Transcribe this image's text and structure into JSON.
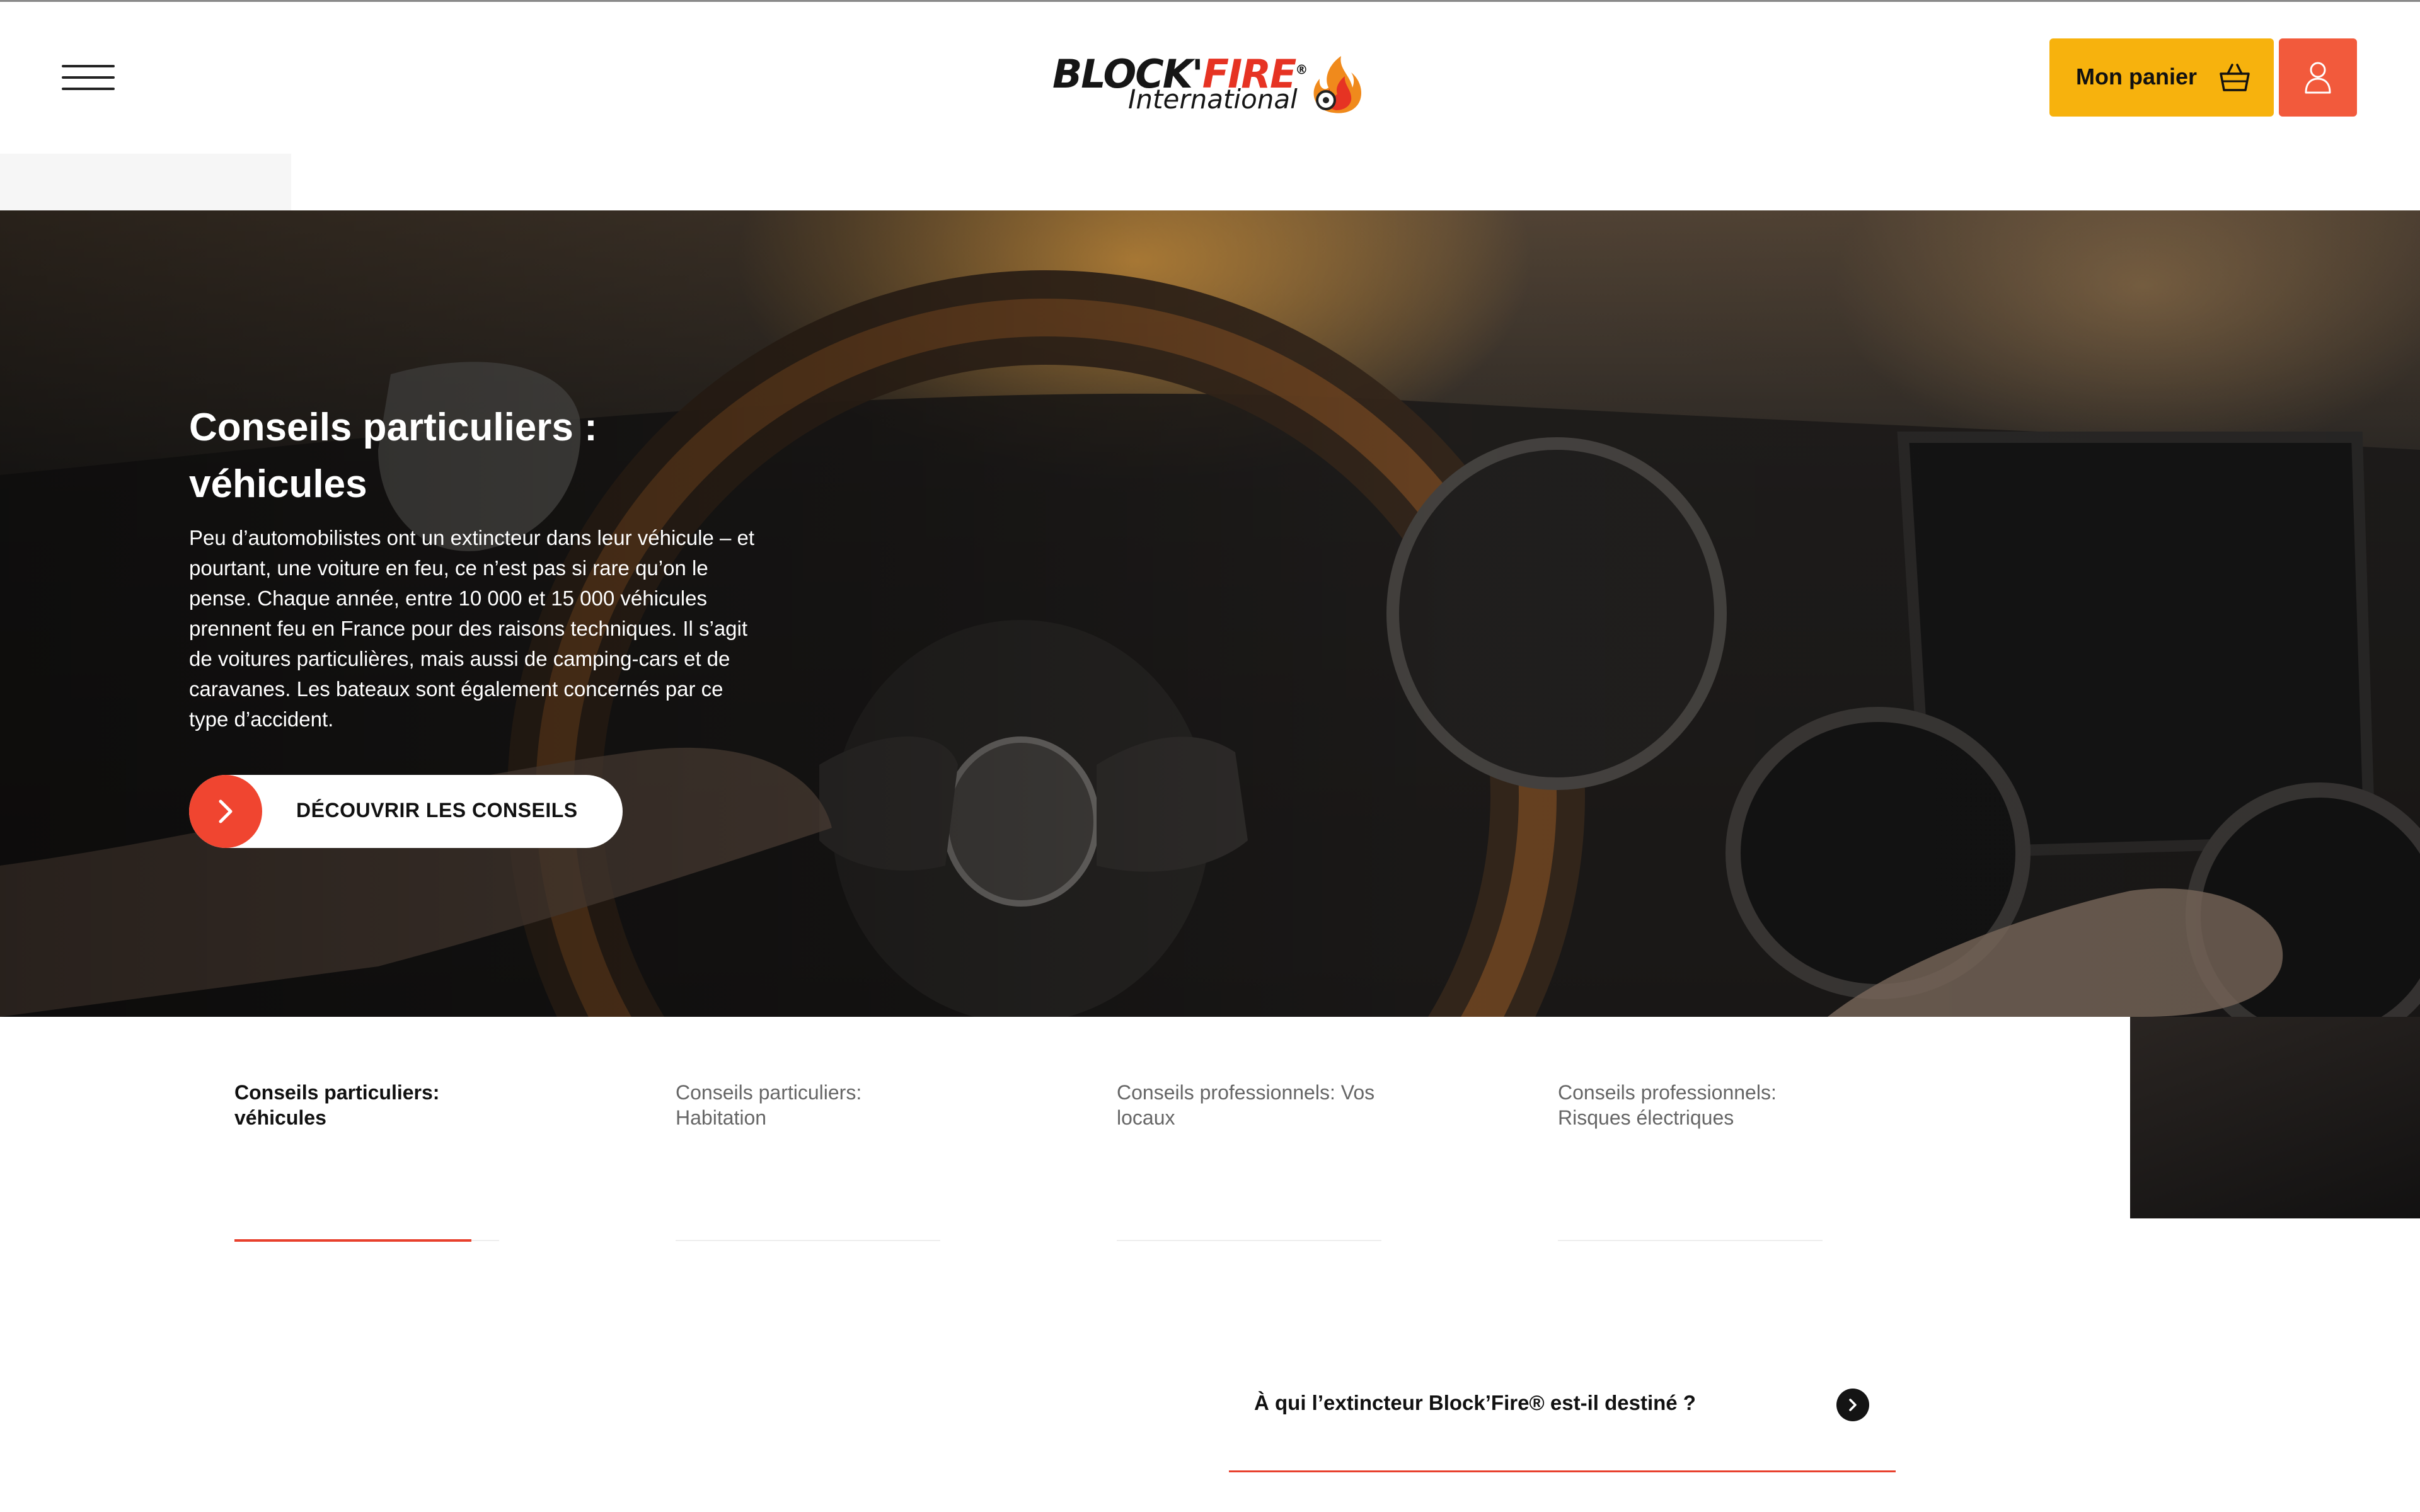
{
  "header": {
    "menu_icon": "hamburger-menu-icon",
    "logo": {
      "brand": "BLOCK'",
      "brand_accent": "FIRE",
      "registered": "®",
      "subtitle": "International"
    },
    "cart_label": "Mon panier",
    "cart_icon": "basket-icon",
    "account_icon": "user-icon",
    "colors": {
      "cart": "#f7b20d",
      "account": "#f25a3c",
      "accent": "#e8402d"
    }
  },
  "hero": {
    "title": "Conseils particuliers : véhicules",
    "text": "Peu d’automobilistes ont un extincteur dans leur véhicule – et pourtant, une voiture en feu, ce n’est pas si rare qu’on le pense. Chaque année, entre 10 000 et 15 000 véhicules prennent feu en France pour des raisons techniques. Il s’agit de voitures particulières, mais aussi de camping-cars et de caravanes. Les bateaux sont également concernés par ce type d’accident.",
    "cta_label": "DÉCOUVRIR LES CONSEILS",
    "cta_icon": "chevron-right-icon"
  },
  "tabs": [
    {
      "label": "Conseils particuliers: véhicules",
      "active": true
    },
    {
      "label": "Conseils particuliers: Habitation",
      "active": false
    },
    {
      "label": "Conseils professionnels: Vos locaux",
      "active": false
    },
    {
      "label": "Conseils professionnels: Risques électriques",
      "active": false
    }
  ],
  "faq": {
    "question": "À qui l’extincteur Block’Fire® est-il destiné ?",
    "icon": "chevron-right-icon"
  }
}
